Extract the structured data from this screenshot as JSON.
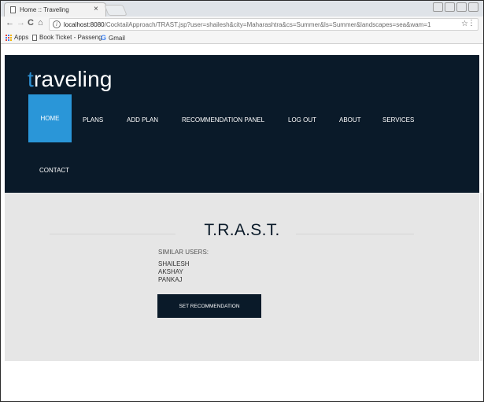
{
  "browser": {
    "tab_title": "Home :: Traveling",
    "tab_close": "×",
    "url_host": "localhost:8080",
    "url_rest": "/CocktailApproach/TRAST.jsp?user=shailesh&city=Maharashtra&cs=Summer&ls=Summer&landscapes=sea&wam=1",
    "info_icon": "i",
    "star_icon": "☆",
    "menu_icon": "⋮",
    "back_icon": "←",
    "forward_icon": "→",
    "reload_icon": "C",
    "home_icon": "⌂",
    "bookmarks": {
      "apps": "Apps",
      "book_ticket": "Book Ticket - Passeng",
      "gmail_icon": "G",
      "gmail": "Gmail"
    }
  },
  "site": {
    "logo_first": "t",
    "logo_rest": "raveling",
    "nav": [
      "HOME",
      "PLANS",
      "ADD PLAN",
      "RECOMMENDATION PANEL",
      "LOG OUT",
      "ABOUT",
      "SERVICES",
      "CONTACT"
    ]
  },
  "main": {
    "title": "T.R.A.S.T.",
    "similar_users_label": "SIMILAR USERS:",
    "users": [
      "SHAILESH",
      "AKSHAY",
      "PANKAJ"
    ],
    "button_label": "SET RECOMMENDATION"
  },
  "colors": {
    "header_bg": "#0a1a29",
    "active_nav": "#2a96d8",
    "logo_accent": "#2d8fd1",
    "content_bg": "#e6e6e6"
  }
}
